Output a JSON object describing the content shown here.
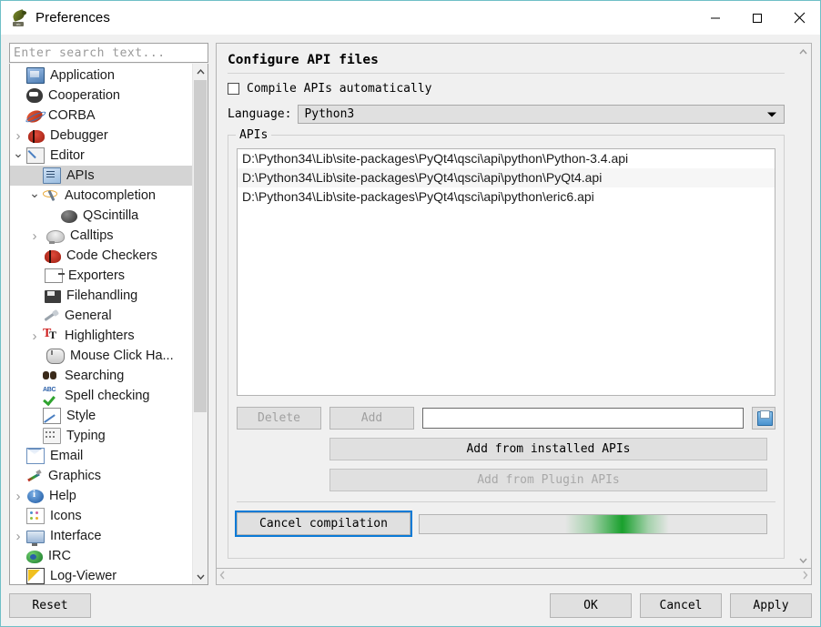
{
  "window": {
    "title": "Preferences",
    "icon": "eric-ide-icon",
    "controls": {
      "minimize": "minimize-icon",
      "maximize": "maximize-icon",
      "close": "close-icon"
    }
  },
  "sidebar": {
    "search_placeholder": "Enter search text...",
    "items": [
      {
        "label": "Application",
        "icon": "application-icon",
        "indent": 1,
        "arrow": "none",
        "selected": false
      },
      {
        "label": "Cooperation",
        "icon": "cooperation-icon",
        "indent": 1,
        "arrow": "none",
        "selected": false
      },
      {
        "label": "CORBA",
        "icon": "corba-icon",
        "indent": 1,
        "arrow": "none",
        "selected": false
      },
      {
        "label": "Debugger",
        "icon": "debugger-icon",
        "indent": 1,
        "arrow": "closed",
        "selected": false
      },
      {
        "label": "Editor",
        "icon": "editor-icon",
        "indent": 1,
        "arrow": "open",
        "selected": false
      },
      {
        "label": "APIs",
        "icon": "apis-icon",
        "indent": 2,
        "arrow": "none",
        "selected": true
      },
      {
        "label": "Autocompletion",
        "icon": "autocompletion-icon",
        "indent": 2,
        "arrow": "open",
        "selected": false
      },
      {
        "label": "QScintilla",
        "icon": "qscintilla-icon",
        "indent": 3,
        "arrow": "none",
        "selected": false
      },
      {
        "label": "Calltips",
        "icon": "calltips-icon",
        "indent": 2,
        "arrow": "closed",
        "selected": false
      },
      {
        "label": "Code Checkers",
        "icon": "code-checkers-icon",
        "indent": 2,
        "arrow": "none",
        "selected": false
      },
      {
        "label": "Exporters",
        "icon": "exporters-icon",
        "indent": 2,
        "arrow": "none",
        "selected": false
      },
      {
        "label": "Filehandling",
        "icon": "filehandling-icon",
        "indent": 2,
        "arrow": "none",
        "selected": false
      },
      {
        "label": "General",
        "icon": "general-icon",
        "indent": 2,
        "arrow": "none",
        "selected": false
      },
      {
        "label": "Highlighters",
        "icon": "highlighters-icon",
        "indent": 2,
        "arrow": "closed",
        "selected": false
      },
      {
        "label": "Mouse Click Ha...",
        "icon": "mouse-click-icon",
        "indent": 2,
        "arrow": "none",
        "selected": false
      },
      {
        "label": "Searching",
        "icon": "searching-icon",
        "indent": 2,
        "arrow": "none",
        "selected": false
      },
      {
        "label": "Spell checking",
        "icon": "spell-checking-icon",
        "indent": 2,
        "arrow": "none",
        "selected": false
      },
      {
        "label": "Style",
        "icon": "style-icon",
        "indent": 2,
        "arrow": "none",
        "selected": false
      },
      {
        "label": "Typing",
        "icon": "typing-icon",
        "indent": 2,
        "arrow": "none",
        "selected": false
      },
      {
        "label": "Email",
        "icon": "email-icon",
        "indent": 1,
        "arrow": "none",
        "selected": false
      },
      {
        "label": "Graphics",
        "icon": "graphics-icon",
        "indent": 1,
        "arrow": "none",
        "selected": false
      },
      {
        "label": "Help",
        "icon": "help-icon",
        "indent": 1,
        "arrow": "closed",
        "selected": false
      },
      {
        "label": "Icons",
        "icon": "icons-icon",
        "indent": 1,
        "arrow": "none",
        "selected": false
      },
      {
        "label": "Interface",
        "icon": "interface-icon",
        "indent": 1,
        "arrow": "closed",
        "selected": false
      },
      {
        "label": "IRC",
        "icon": "irc-icon",
        "indent": 1,
        "arrow": "none",
        "selected": false
      },
      {
        "label": "Log-Viewer",
        "icon": "log-viewer-icon",
        "indent": 1,
        "arrow": "none",
        "selected": false
      },
      {
        "label": "",
        "icon": "minimap-icon",
        "indent": 1,
        "arrow": "none",
        "selected": false
      }
    ],
    "scroll_up_icon": "chevron-up-icon",
    "scroll_down_icon": "chevron-down-icon"
  },
  "main": {
    "title": "Configure API files",
    "compile_checkbox": {
      "label": "Compile APIs automatically",
      "checked": false
    },
    "language": {
      "label": "Language:",
      "value": "Python3",
      "caret_icon": "chevron-down-icon"
    },
    "apis_group": {
      "legend": "APIs",
      "files": [
        "D:\\Python34\\Lib\\site-packages\\PyQt4\\qsci\\api\\python\\Python-3.4.api",
        "D:\\Python34\\Lib\\site-packages\\PyQt4\\qsci\\api\\python\\PyQt4.api",
        "D:\\Python34\\Lib\\site-packages\\PyQt4\\qsci\\api\\python\\eric6.api"
      ],
      "delete_button": {
        "label": "Delete",
        "enabled": false
      },
      "add_button": {
        "label": "Add",
        "enabled": false
      },
      "path_input_value": "",
      "browse_button_icon": "open-file-icon",
      "add_installed_button": {
        "label": "Add from installed APIs",
        "enabled": true
      },
      "add_plugin_button": {
        "label": "Add from Plugin APIs",
        "enabled": false
      }
    },
    "cancel_compilation_button": {
      "label": "Cancel compilation",
      "focused": true
    },
    "progress": {
      "indeterminate": true,
      "color": "#19a02d"
    },
    "scroll_up_icon": "chevron-up-icon",
    "scroll_down_icon": "chevron-down-icon",
    "scroll_left_icon": "chevron-left-icon",
    "scroll_right_icon": "chevron-right-icon"
  },
  "footer": {
    "reset": "Reset",
    "ok": "OK",
    "cancel": "Cancel",
    "apply": "Apply"
  }
}
